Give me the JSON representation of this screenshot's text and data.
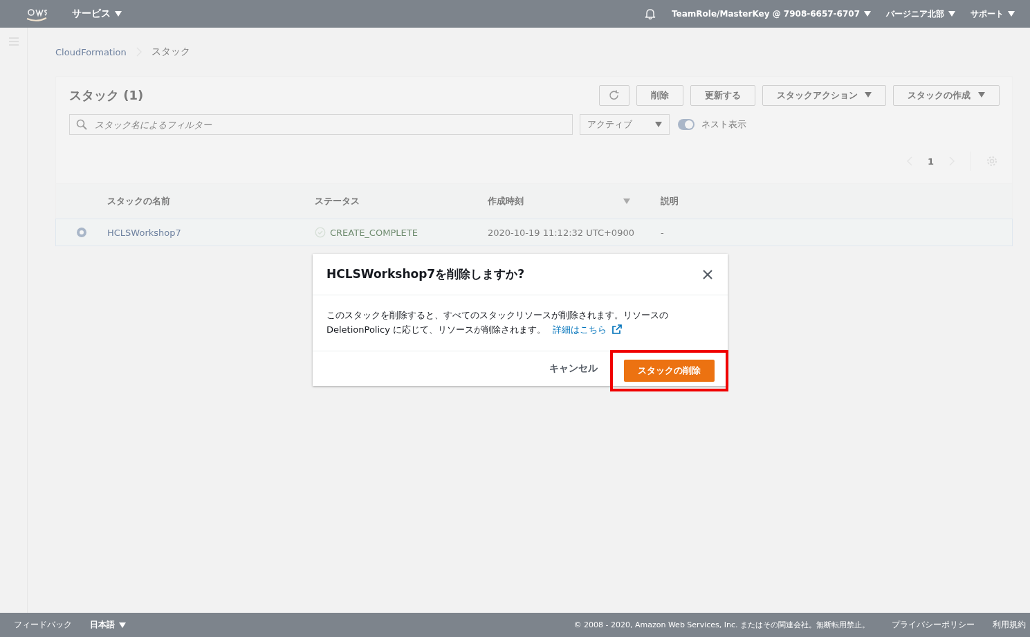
{
  "top_bar": {
    "services": "サービス",
    "account": "TeamRole/MasterKey @ 7908-6657-6707",
    "region": "バージニア北部",
    "support": "サポート"
  },
  "breadcrumb": [
    "CloudFormation",
    "スタック"
  ],
  "stacks_panel": {
    "title": "スタック",
    "count": "(1)",
    "buttons": [
      {
        "kind": "refresh"
      },
      {
        "kind": "plain",
        "label": "削除"
      },
      {
        "kind": "plain",
        "label": "更新する"
      },
      {
        "kind": "dropdown",
        "label": "スタックアクション"
      },
      {
        "kind": "dropdown",
        "label": "スタックの作成"
      }
    ],
    "search": {
      "placeholder": "スタック名によるフィルター"
    },
    "status_filter": "アクティブ",
    "nested_toggle": {
      "label": "ネスト表示",
      "on": true
    },
    "page": "1",
    "columns": [
      {
        "label": "スタックの名前",
        "sorted": false
      },
      {
        "label": "ステータス",
        "sorted": false
      },
      {
        "label": "作成時刻",
        "sorted": true
      },
      {
        "label": "説明",
        "sorted": false
      }
    ],
    "rows": [
      {
        "selected": true,
        "name": "HCLSWorkshop7",
        "status": "CREATE_COMPLETE",
        "created": "2020-10-19 11:12:32 UTC+0900",
        "description": "-"
      }
    ]
  },
  "dialog": {
    "title": "HCLSWorkshop7を削除しますか?",
    "body": "このスタックを削除すると、すべてのスタックリソースが削除されます。リソースの DeletionPolicy に応じて、リソースが削除されます。",
    "link": "詳細はこちら",
    "cancel": "キャンセル",
    "confirm": "スタックの削除",
    "highlighted": true
  },
  "footer": {
    "feedback": "フィードバック",
    "language": "日本語",
    "copyright": "© 2008 - 2020, Amazon Web Services, Inc. またはその関連会社。無断転用禁止。",
    "privacy": "プライバシーポリシー",
    "terms": "利用規約"
  }
}
